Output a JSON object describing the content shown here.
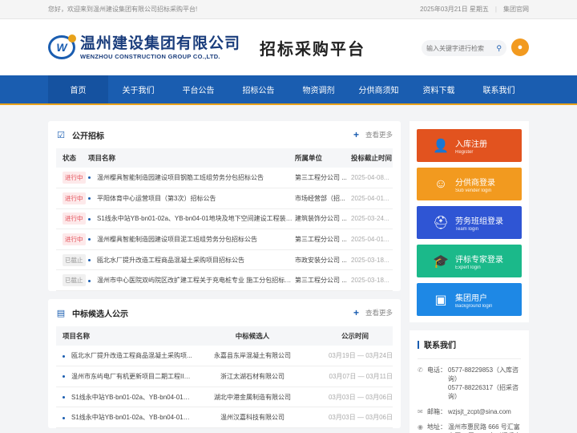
{
  "topbar": {
    "welcome": "您好，欢迎来到温州建设集团有限公司招标采购平台!",
    "date": "2025年03月21日 星期五",
    "sep": "|",
    "official_site": "集团官网"
  },
  "header": {
    "logo_mark": "W",
    "logo_cn": "温州建设集团有限公司",
    "logo_en": "WENZHOU CONSTRUCTION GROUP CO.,LTD.",
    "platform_title": "招标采购平台",
    "search_placeholder": "输入关键字进行检索"
  },
  "nav": {
    "items": [
      "首页",
      "关于我们",
      "平台公告",
      "招标公告",
      "物资调剂",
      "分供商须知",
      "资料下载",
      "联系我们"
    ]
  },
  "tender": {
    "title": "公开招标",
    "more": "查看更多",
    "columns": [
      "状态",
      "项目名称",
      "所属单位",
      "投标截止时间"
    ],
    "rows": [
      {
        "status": "进行中",
        "name": "温州樱具智能制造园建设项目钢筋工班组劳务分包招标公告",
        "unit": "第三工程分公司 ...",
        "deadline": "2025-04-08..."
      },
      {
        "status": "进行中",
        "name": "平阳体育中心运营项目（第3次）招标公告",
        "unit": "市场经营部（招...",
        "deadline": "2025-04-01..."
      },
      {
        "status": "进行中",
        "name": "S1线永中站YB-bn01-02a、YB-bn04-01地块及地下空间建设工程装饰装...",
        "unit": "建筑装饰分公司 ...",
        "deadline": "2025-03-24..."
      },
      {
        "status": "进行中",
        "name": "温州樱具智能制造园建设项目泥工班组劳务分包招标公告",
        "unit": "第三工程分公司 ...",
        "deadline": "2025-04-01..."
      },
      {
        "status": "已截止",
        "name": "瓯北水厂提升改造工程商品混凝土采购项目招标公告",
        "unit": "市政安装分公司 ...",
        "deadline": "2025-03-18..."
      },
      {
        "status": "已截止",
        "name": "温州市中心医院双屿院区改扩建工程关于充电桩专业 施工分包招标公告",
        "unit": "第三工程分公司 ...",
        "deadline": "2025-03-18..."
      }
    ]
  },
  "candidates": {
    "title": "中标候选人公示",
    "more": "查看更多",
    "columns": [
      "项目名称",
      "中标候选人",
      "公示时间"
    ],
    "rows": [
      {
        "name": "瓯北水厂提升改造工程商品混凝土采购项...",
        "candidate": "永嘉县东岸混凝土有限公司",
        "period": "03月19日 — 03月24日"
      },
      {
        "name": "温州市东屿电厂有机更新项目二期工程II标...",
        "candidate": "浙江太湖石材有限公司",
        "period": "03月07日 — 03月11日"
      },
      {
        "name": "S1线永中站YB-bn01-02a、YB-bn04-01地...",
        "candidate": "湖北中港金属制造有限公司",
        "period": "03月03日 — 03月06日"
      },
      {
        "name": "S1线永中站YB-bn01-02a、YB-bn04-01地...",
        "candidate": "温州汉嘉科技有限公司",
        "period": "03月03日 — 03月06日"
      }
    ]
  },
  "quick_links": [
    {
      "cn": "入库注册",
      "en": "Register",
      "color": "#e2531f",
      "icon": "user-add-icon",
      "glyph": "👤"
    },
    {
      "cn": "分供商登录",
      "en": "Sub vender login",
      "color": "#f29a1f",
      "icon": "vendor-icon",
      "glyph": "☺"
    },
    {
      "cn": "劳务班组登录",
      "en": "Team login",
      "color": "#2f55d4",
      "icon": "worker-icon",
      "glyph": "⛑"
    },
    {
      "cn": "评标专家登录",
      "en": "Expert login",
      "color": "#1bb98a",
      "icon": "expert-icon",
      "glyph": "🎓"
    },
    {
      "cn": "集团用户",
      "en": "Background login",
      "color": "#1e88e5",
      "icon": "group-user-icon",
      "glyph": "▣"
    }
  ],
  "contact": {
    "title": "联系我们",
    "phone_label": "电话：",
    "phone_lines": [
      "0577-88229853（入库咨询）",
      "0577-88226317（招采咨询）"
    ],
    "email_label": "邮箱：",
    "email": "wzjsjt_zcpt@sina.com",
    "address_label": "地址：",
    "address": "温州市惠民路 666 号汇富大厦 3 层 303 室（招采中心）"
  }
}
